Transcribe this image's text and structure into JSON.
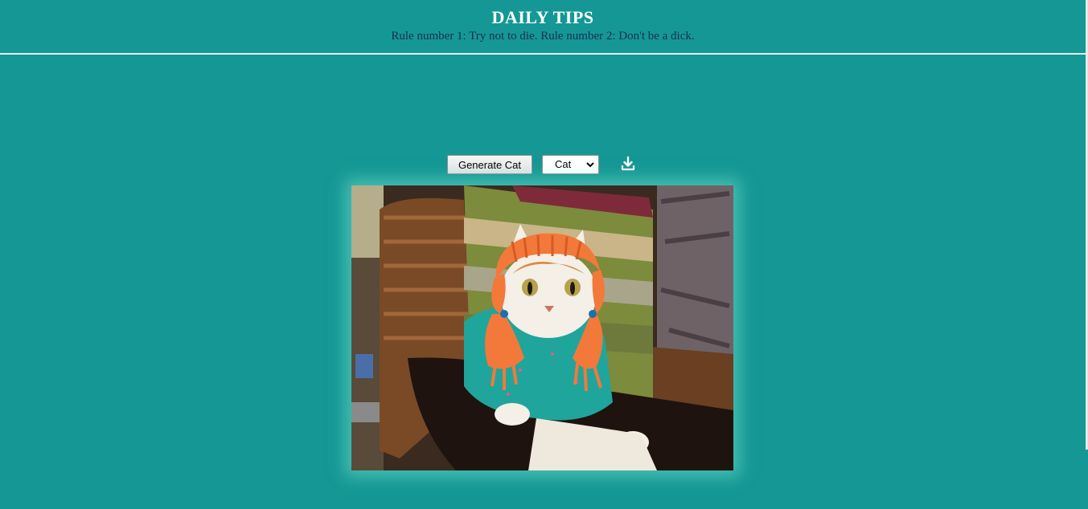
{
  "header": {
    "title": "DAILY TIPS",
    "subtitle": "Rule number 1: Try not to die. Rule number 2: Don't be a dick."
  },
  "controls": {
    "generate_label": "Generate Cat",
    "select": {
      "selected": "Cat"
    },
    "download_icon": "download-icon"
  },
  "image": {
    "subject": "cat-photo"
  },
  "colors": {
    "background": "#159895",
    "title": "#ffffff",
    "subtitle": "#1a2c58",
    "glow": "#6edcc8"
  }
}
